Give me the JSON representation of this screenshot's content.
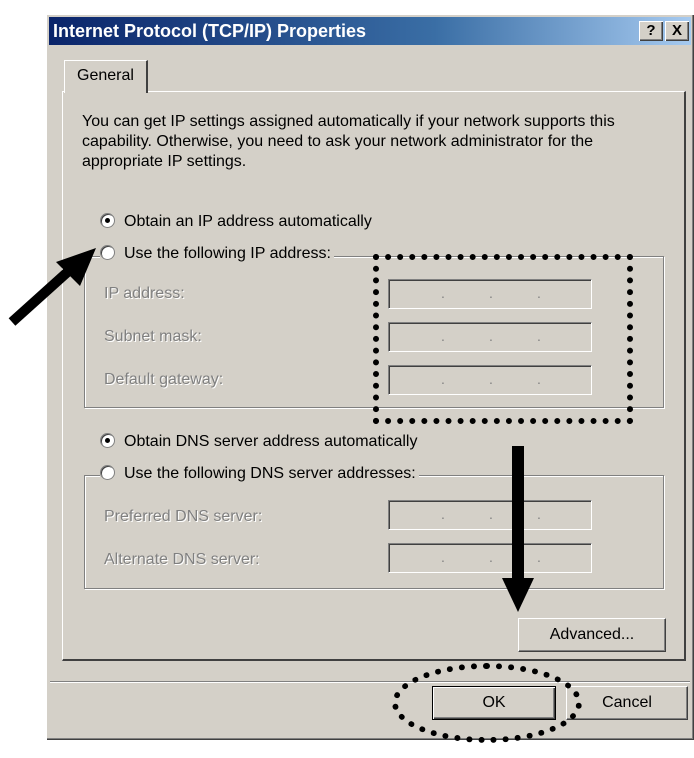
{
  "window": {
    "title": "Internet Protocol (TCP/IP) Properties",
    "help_label": "?",
    "close_label": "X"
  },
  "tabs": [
    {
      "label": "General"
    }
  ],
  "description": "You can get IP settings assigned automatically if your network supports this capability. Otherwise, you need to ask your network administrator for the appropriate IP settings.",
  "ip": {
    "auto_label": "Obtain an IP address automatically",
    "manual_label": "Use the following IP address:",
    "selected": "auto",
    "fields": [
      {
        "label": "IP address:",
        "value": ". . ."
      },
      {
        "label": "Subnet mask:",
        "value": ". . ."
      },
      {
        "label": "Default gateway:",
        "value": ". . ."
      }
    ]
  },
  "dns": {
    "auto_label": "Obtain DNS server address automatically",
    "manual_label": "Use the following DNS server addresses:",
    "selected": "auto",
    "fields": [
      {
        "label": "Preferred DNS server:",
        "value": ". . ."
      },
      {
        "label": "Alternate DNS server:",
        "value": ". . ."
      }
    ]
  },
  "buttons": {
    "advanced": "Advanced...",
    "ok": "OK",
    "cancel": "Cancel"
  }
}
